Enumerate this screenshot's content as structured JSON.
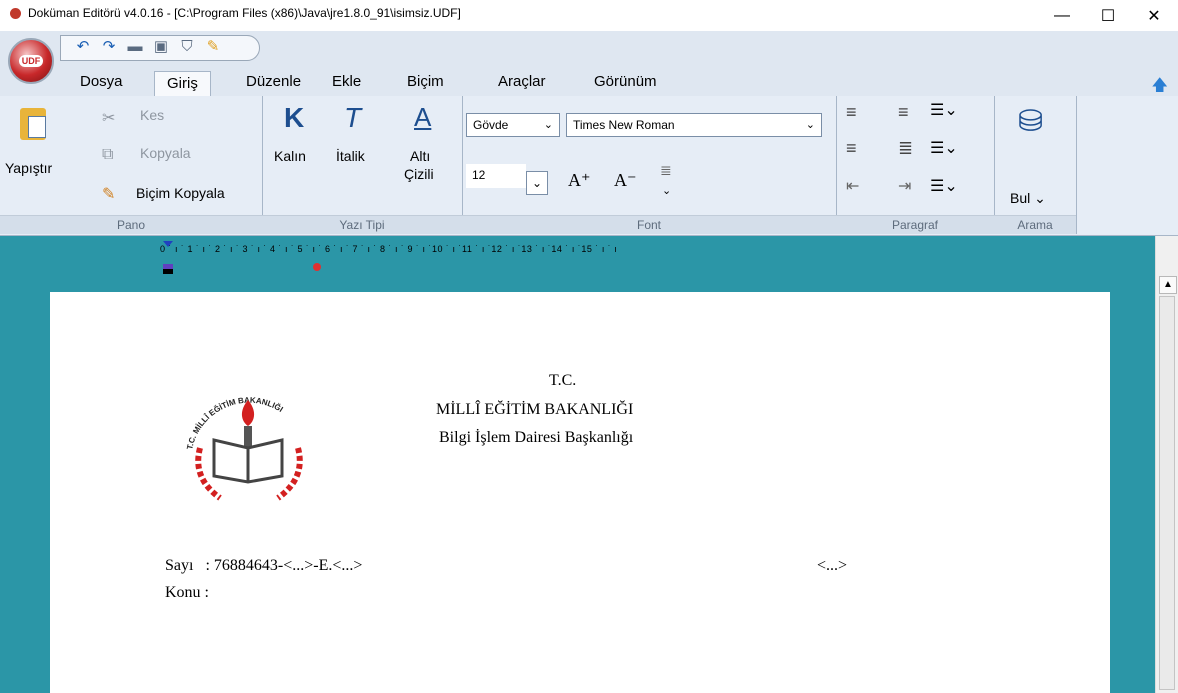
{
  "window": {
    "title": "Doküman Editörü v4.0.16 - [C:\\Program Files (x86)\\Java\\jre1.8.0_91\\isimsiz.UDF]",
    "minimize": "—",
    "maximize": "☐",
    "close": "✕"
  },
  "app_logo": "UDF",
  "tabs": [
    "Dosya",
    "Giriş",
    "Düzenle",
    "Ekle",
    "Biçim",
    "Araçlar",
    "Görünüm"
  ],
  "ribbon": {
    "pano": {
      "label": "Pano",
      "paste": "Yapıştır",
      "cut": "Kes",
      "copy": "Kopyala",
      "format_painter": "Biçim Kopyala"
    },
    "yazi_tipi": {
      "label": "Yazı Tipi",
      "bold_glyph": "K",
      "italic_glyph": "T",
      "underline_glyph": "A",
      "bold": "Kalın",
      "italic": "İtalik",
      "underline_1": "Altı",
      "underline_2": "Çizili"
    },
    "font": {
      "label": "Font",
      "style": "Gövde",
      "family": "Times New Roman",
      "size": "12",
      "grow": "A⁺",
      "shrink": "A⁻"
    },
    "paragraf": {
      "label": "Paragraf"
    },
    "arama": {
      "label": "Arama",
      "find": "Bul ⌄"
    }
  },
  "ruler_text": "0 ˙ ı ˙ 1 ˙ ı ˙ 2 ˙ ı ˙ 3 ˙ ı ˙ 4 ˙ ı ˙ 5 ˙ ı ˙ 6 ˙ ı ˙ 7 ˙ ı ˙ 8 ˙ ı ˙ 9 ˙ ı ˙10 ˙ ı ˙11 ˙ ı ˙12 ˙ ı ˙13 ˙ ı ˙14 ˙ ı ˙15 ˙ ı ˙ ı",
  "document": {
    "logo_arc": "T.C. MİLLÎ EĞİTİM BAKANLIĞI",
    "header_line1": "T.C.",
    "header_line2": "MİLLÎ EĞİTİM BAKANLIĞI",
    "header_line3": "Bilgi İşlem Dairesi Başkanlığı",
    "sayi": "Sayı   : 76884643-<...>-E.<...>",
    "date": "<...>",
    "konu": "Konu :"
  }
}
